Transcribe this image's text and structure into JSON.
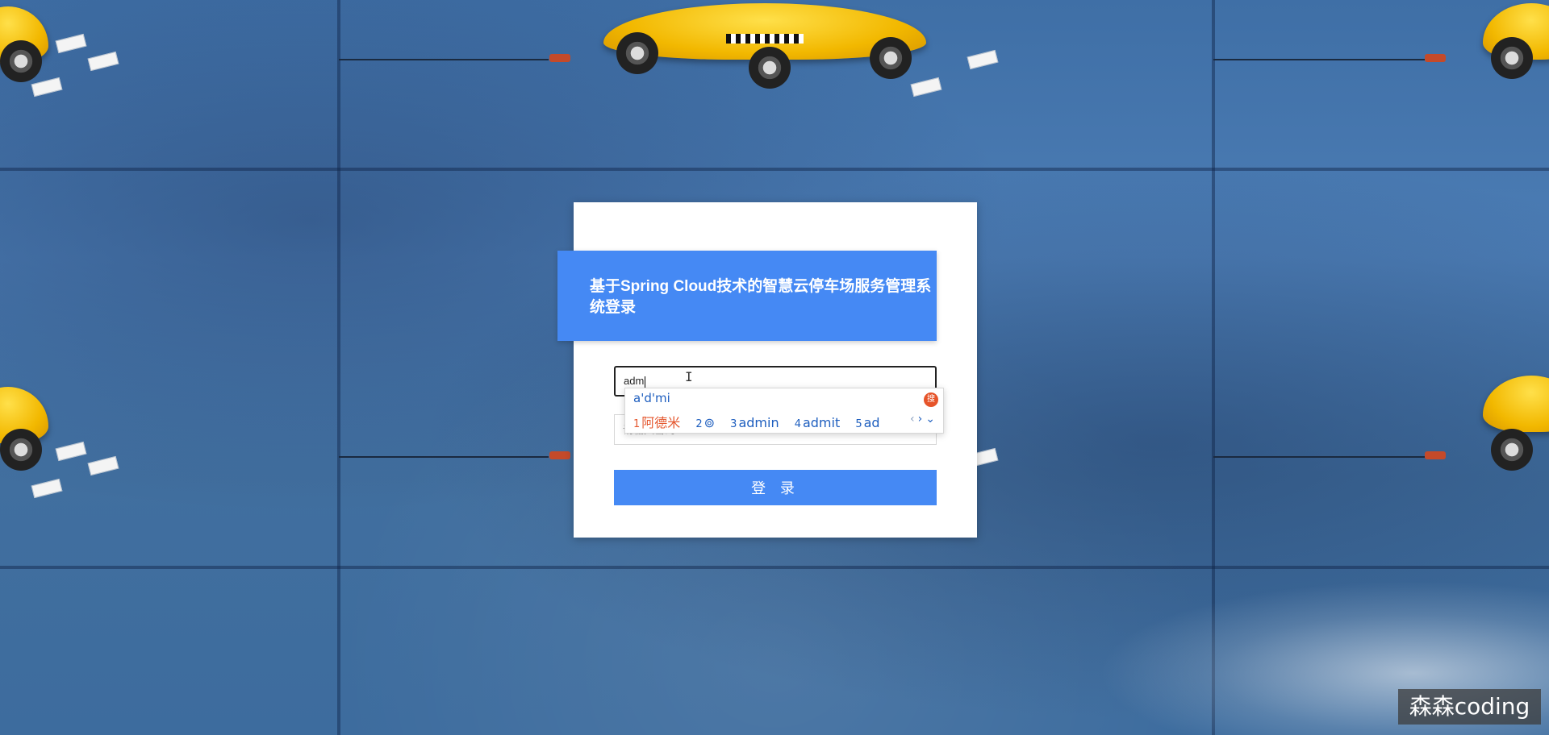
{
  "login": {
    "title": "基于Spring Cloud技术的智慧云停车场服务管理系统登录",
    "username_value": "adm",
    "password_placeholder": "请输入密码",
    "login_button_label": "登 录"
  },
  "ime": {
    "pinyin": "a'd'mi",
    "logo_label": "搜",
    "candidates": [
      {
        "num": "1",
        "text": "阿德米"
      },
      {
        "num": "2",
        "text": "⊚"
      },
      {
        "num": "3",
        "text": "admin"
      },
      {
        "num": "4",
        "text": "admit"
      },
      {
        "num": "5",
        "text": "ad"
      }
    ],
    "nav": {
      "prev": "‹",
      "next": "›",
      "expand": "⌄"
    }
  },
  "watermark": "森森coding",
  "colors": {
    "accent": "#4589f4",
    "background": "#4c7db5",
    "ime_selected": "#e4572e"
  },
  "icons": {
    "ime_logo": "sogou-ime-icon",
    "cursor": "text-ibeam-cursor-icon"
  }
}
